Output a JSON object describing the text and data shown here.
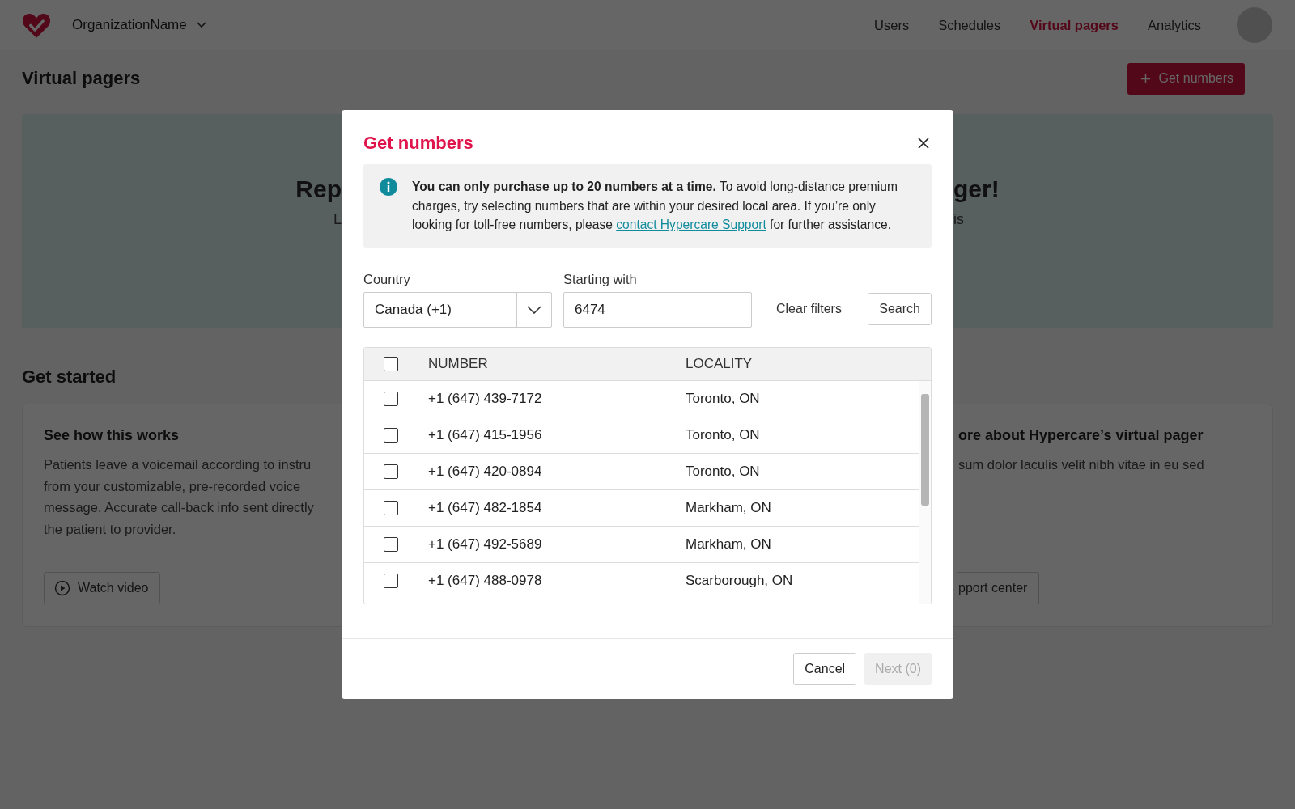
{
  "header": {
    "org_name": "OrganizationName",
    "nav": [
      {
        "label": "Users",
        "selected": false
      },
      {
        "label": "Schedules",
        "selected": false
      },
      {
        "label": "Virtual pagers",
        "selected": true
      },
      {
        "label": "Analytics",
        "selected": false
      }
    ]
  },
  "page": {
    "title": "Virtual pagers",
    "action_button": "Get numbers",
    "hero": {
      "title_left": "Rep",
      "title_right": "ger!",
      "subtitle_left": "L",
      "subtitle_right": "is"
    },
    "section_title": "Get started",
    "cards": [
      {
        "title": "See how this works",
        "lines": [
          "Patients leave a voicemail according to instru",
          "from your customizable, pre-recorded voice",
          "message. Accurate call-back info sent directly",
          "the patient to provider."
        ],
        "button": "Watch video"
      },
      {
        "title": "ore about Hypercare’s virtual pager",
        "lines": [
          "sum dolor laculis velit nibh vitae in eu sed"
        ],
        "button": "pport center"
      }
    ]
  },
  "modal": {
    "title": "Get numbers",
    "info": {
      "bold": "You can only purchase up to 20 numbers at a time.",
      "text": " To avoid long-distance premium charges, try selecting numbers that are within your desired local area. If you’re only looking for toll-free numbers, please ",
      "link": "contact Hypercare Support",
      "after": " for further assistance."
    },
    "country": {
      "label": "Country",
      "value": "Canada (+1)"
    },
    "starting_with": {
      "label": "Starting with",
      "value": "6474"
    },
    "clear_button": "Clear filters",
    "search_button": "Search",
    "table": {
      "header_checked": false,
      "columns": [
        "NUMBER",
        "LOCALITY"
      ],
      "rows": [
        {
          "number": "+1 (647) 439-7172",
          "locality": "Toronto, ON",
          "checked": false
        },
        {
          "number": "+1 (647) 415-1956",
          "locality": "Toronto, ON",
          "checked": false
        },
        {
          "number": "+1 (647) 420-0894",
          "locality": "Toronto, ON",
          "checked": false
        },
        {
          "number": "+1 (647) 482-1854",
          "locality": "Markham, ON",
          "checked": false
        },
        {
          "number": "+1 (647) 492-5689",
          "locality": "Markham, ON",
          "checked": false
        },
        {
          "number": "+1 (647) 488-0978",
          "locality": "Scarborough, ON",
          "checked": false
        }
      ]
    },
    "cancel_button": "Cancel",
    "next_button": {
      "label": "Next (0)",
      "disabled": true
    }
  }
}
